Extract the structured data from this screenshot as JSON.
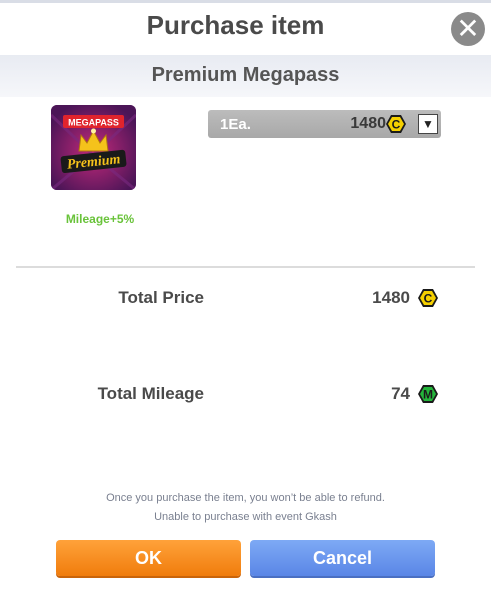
{
  "dialog": {
    "title": "Purchase item",
    "close_icon": "close-icon"
  },
  "item": {
    "name": "Premium Megapass",
    "image_text_top": "MEGAPASS",
    "image_text_main": "Premium",
    "mileage_bonus": "Mileage+5%"
  },
  "quantity_select": {
    "selected": "1Ea.",
    "price": "1480",
    "currency_icon": "gcash-coin-icon",
    "currency_glyph": "C"
  },
  "totals": {
    "total_price_label": "Total Price",
    "total_price_value": "1480",
    "price_currency_glyph": "C",
    "total_mileage_label": "Total Mileage",
    "total_mileage_value": "74",
    "mileage_glyph": "M"
  },
  "notices": {
    "line1": "Once you purchase the item, you won’t be able to refund.",
    "line2": "Unable to purchase with event Gkash"
  },
  "buttons": {
    "ok": "OK",
    "cancel": "Cancel"
  },
  "colors": {
    "coin_fill": "#f5d000",
    "mileage_fill": "#23b43a",
    "ok_button": "#f5870f",
    "cancel_button": "#6a96ee",
    "bonus_text": "#69c33a"
  }
}
